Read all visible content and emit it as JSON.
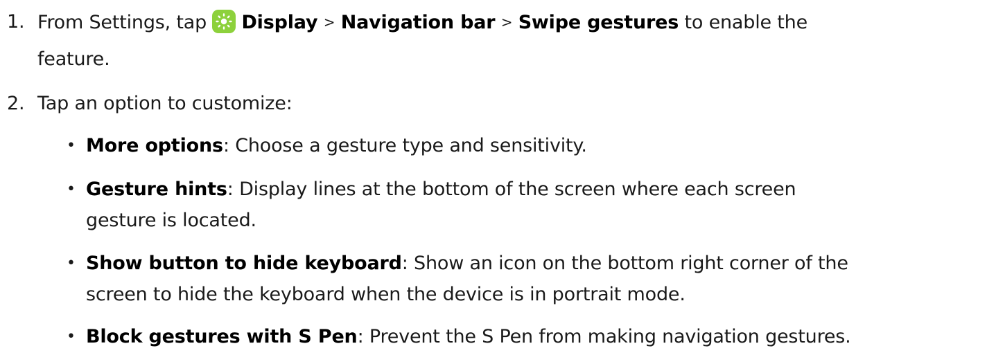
{
  "step1": {
    "number": "1.",
    "prefix": "From Settings, tap",
    "icon": "display-settings-icon",
    "icon_color": "#8dd13c",
    "display": "Display",
    "separator1": ">",
    "navigation_bar": "Navigation bar",
    "separator2": ">",
    "swipe_gestures": "Swipe gestures",
    "suffix": "to enable the",
    "line2": "feature."
  },
  "step2": {
    "number": "2.",
    "text": "Tap an option to customize:"
  },
  "options": [
    {
      "bullet": "•",
      "title": "More options",
      "colon": ":",
      "desc1": "Choose a gesture type and sensitivity.",
      "desc2": ""
    },
    {
      "bullet": "•",
      "title": "Gesture hints",
      "colon": ":",
      "desc1": "Display lines at the bottom of the screen where each screen",
      "desc2": "gesture is located."
    },
    {
      "bullet": "•",
      "title": "Show button to hide keyboard",
      "colon": ":",
      "desc1": "Show an icon on the bottom right corner of the",
      "desc2": "screen to hide the keyboard when the device is in portrait mode."
    },
    {
      "bullet": "•",
      "title": "Block gestures with S Pen",
      "colon": ":",
      "desc1": "Prevent the S Pen from making navigation gestures.",
      "desc2": ""
    }
  ]
}
